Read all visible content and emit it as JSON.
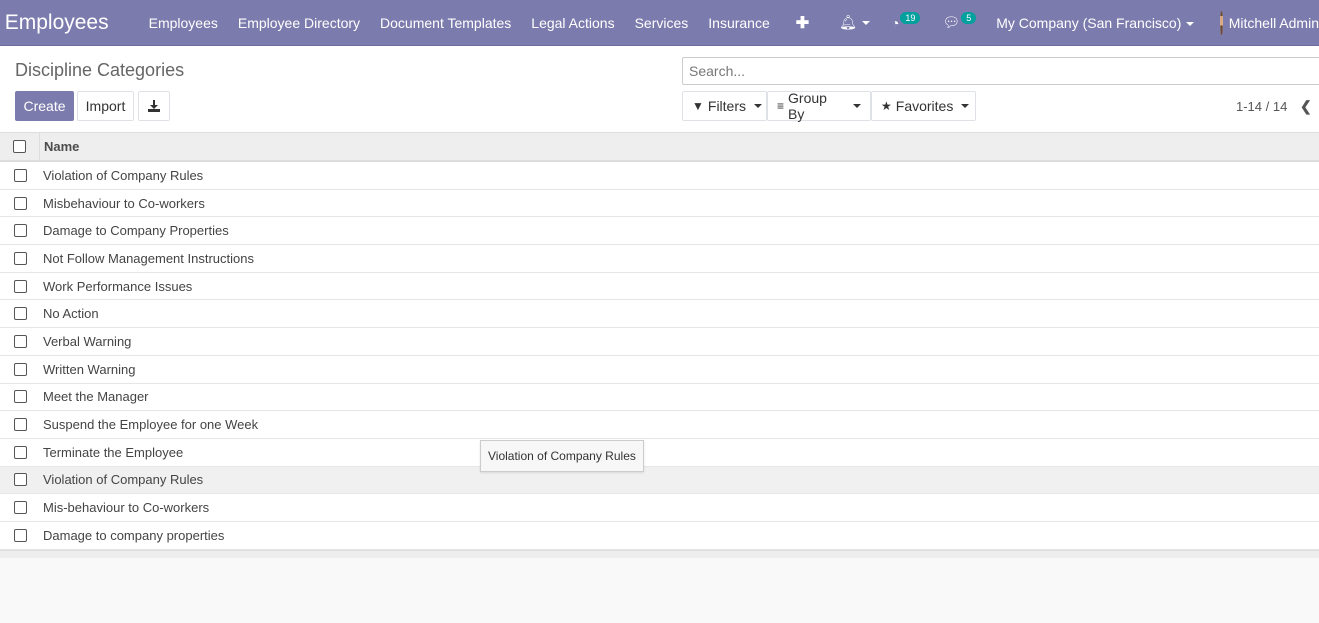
{
  "navbar": {
    "app_title": "Employees",
    "menu": [
      "Employees",
      "Employee Directory",
      "Document Templates",
      "Legal Actions",
      "Services",
      "Insurance"
    ],
    "activity_count": "19",
    "message_count": "5",
    "company": "My Company (San Francisco)",
    "user": "Mitchell Admin",
    "accent_color": "#7c7bad"
  },
  "control": {
    "title": "Discipline Categories",
    "create_label": "Create",
    "import_label": "Import",
    "search_placeholder": "Search...",
    "filters_label": "Filters",
    "groupby_label": "Group By",
    "favorites_label": "Favorites",
    "pager": "1-14 / 14"
  },
  "list": {
    "column_name": "Name",
    "rows": [
      "Violation of Company Rules",
      "Misbehaviour to Co-workers",
      "Damage to Company Properties",
      "Not Follow Management Instructions",
      "Work Performance Issues",
      "No Action",
      "Verbal Warning",
      "Written Warning",
      "Meet the Manager",
      "Suspend the Employee for one Week",
      "Terminate the Employee",
      "Violation of Company Rules",
      "Mis-behaviour to Co-workers",
      "Damage to company properties"
    ]
  },
  "tooltip": "Violation of Company Rules"
}
